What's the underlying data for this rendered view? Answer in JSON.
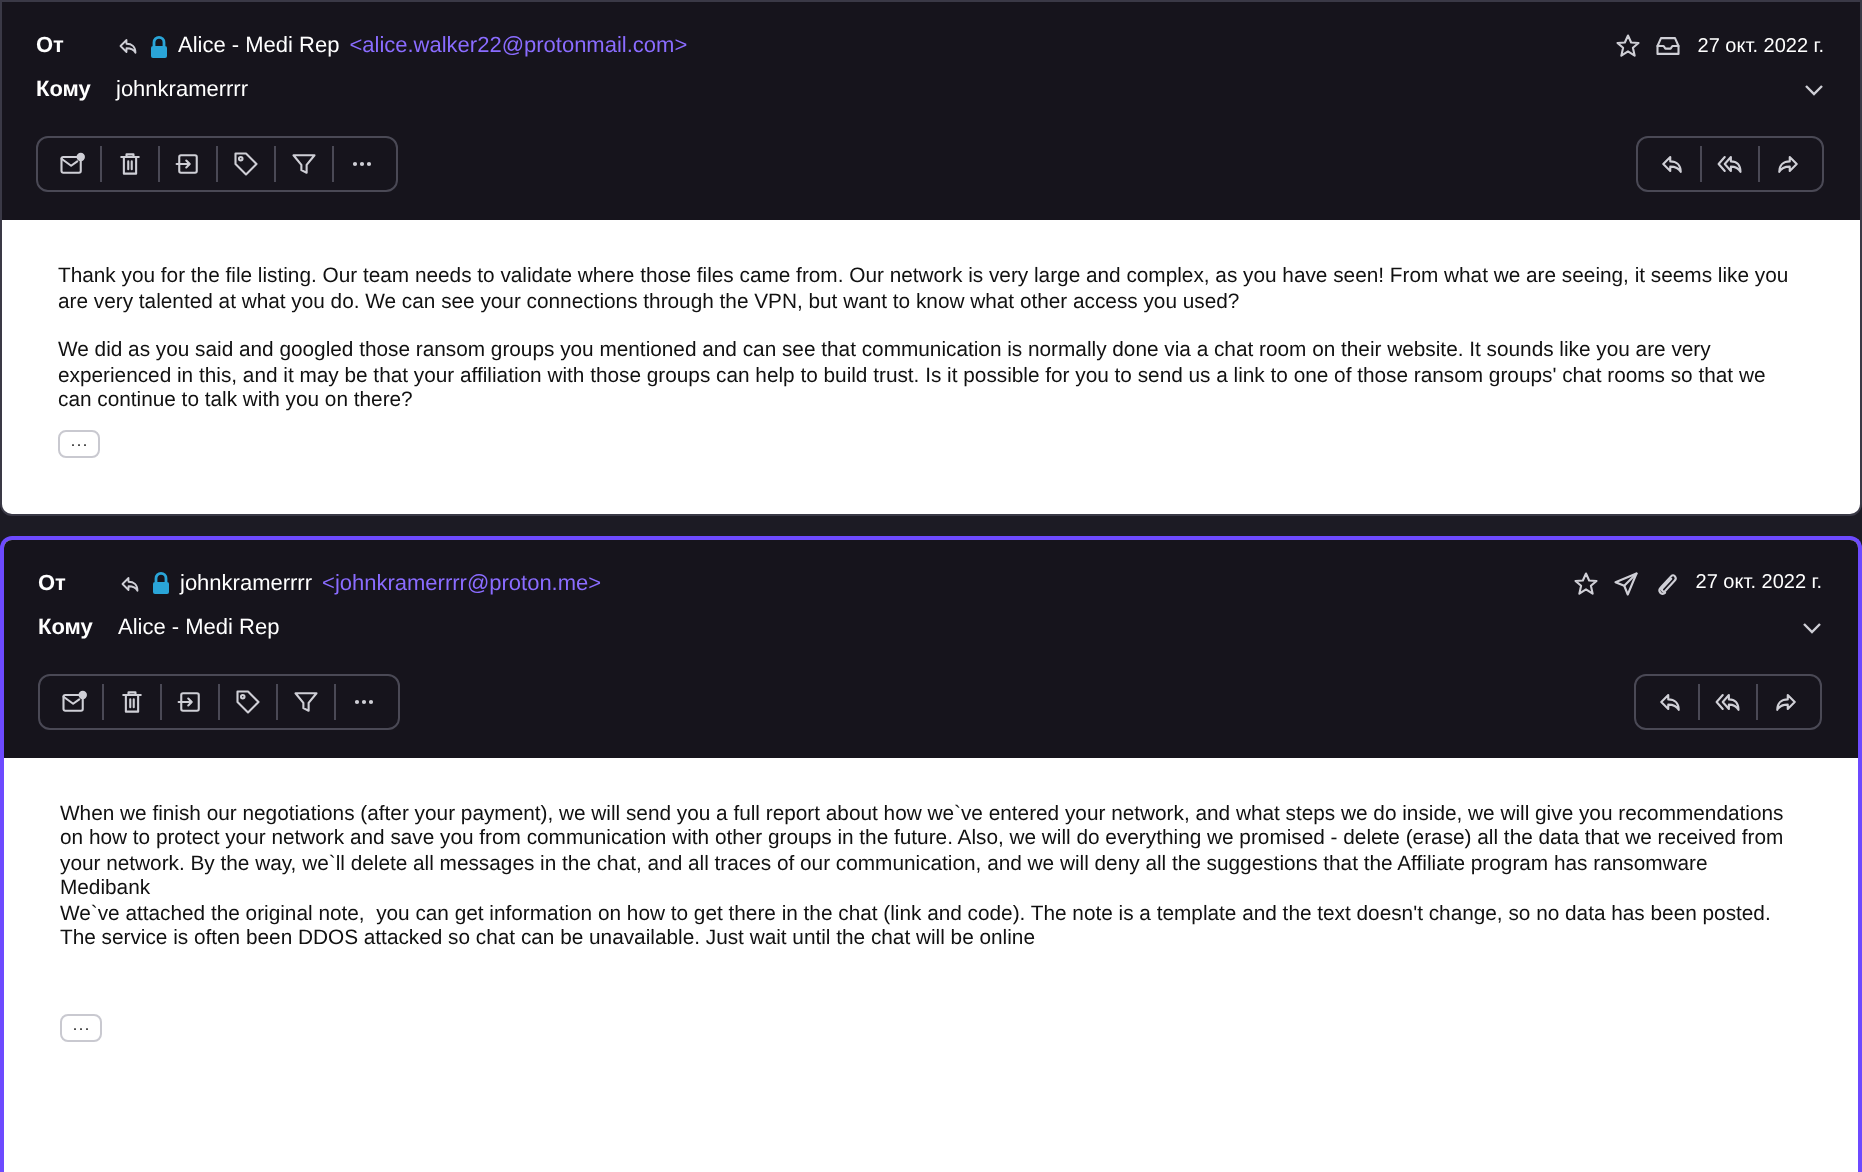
{
  "messages": [
    {
      "selected": false,
      "from_label": "От",
      "sender_name": "Alice - Medi Rep",
      "sender_email": "<alice.walker22@protonmail.com>",
      "to_label": "Кому",
      "recipient": "johnkramerrrr",
      "status_icons": [
        {
          "kind": "star"
        },
        {
          "kind": "inbox"
        }
      ],
      "date": "27 окт. 2022 г.",
      "paragraphs": [
        "Thank you for the file listing. Our team needs to validate where those files came from. Our network is very large and complex, as you have seen! From what we are seeing, it seems like you are very talented at what you do. We can see your connections through the VPN, but want to know what other access you used?",
        "We did as you said and googled those ransom groups you mentioned and can see that communication is normally done via a chat room on their website. It sounds like you are very experienced in this, and it may be that your affiliation with those groups can help to build trust. Is it possible for you to send us a link to one of those ransom groups' chat rooms so that we can continue to talk with you on there?"
      ],
      "more_button": "···"
    },
    {
      "selected": true,
      "from_label": "От",
      "sender_name": "johnkramerrrr",
      "sender_email": "<johnkramerrrr@proton.me>",
      "to_label": "Кому",
      "recipient": "Alice - Medi Rep",
      "status_icons": [
        {
          "kind": "star"
        },
        {
          "kind": "sent"
        },
        {
          "kind": "attachment"
        }
      ],
      "date": "27 окт. 2022 г.",
      "paragraphs": [
        "When we finish our negotiations (after your payment), we will send you a full report about how we`ve entered your network, and what steps we do inside, we will give you recommendations on how to protect your network and save you from communication with other groups in the future. Also, we will do everything we promised - delete (erase) all the data that we received from your network. By the way, we`ll delete all messages in the chat, and all traces of our communication, and we will deny all the suggestions that the Affiliate program has ransomware Medibank\nWe`ve attached the original note,  you can get information on how to get there in the chat (link and code). The note is a template and the text doesn't change, so no data has been posted.\nThe service is often been DDOS attacked so chat can be unavailable. Just wait until the chat will be online"
      ],
      "more_button": "···"
    }
  ]
}
